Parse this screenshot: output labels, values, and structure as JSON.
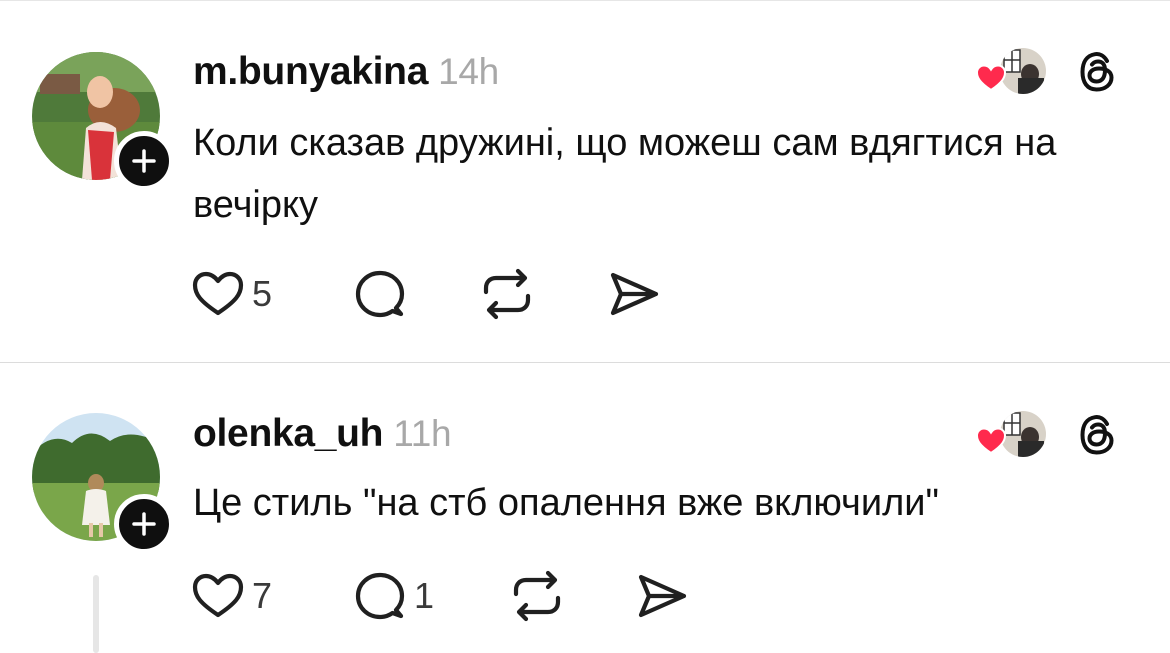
{
  "posts": [
    {
      "username": "m.bunyakina",
      "time": "14h",
      "text": "Коли сказав дружині, що можеш сам вдягтися на вечірку",
      "likes": "5",
      "replies": ""
    },
    {
      "username": "olenka_uh",
      "time": "11h",
      "text": "Це стиль \"на стб опалення вже включили\"",
      "likes": "7",
      "replies": "1"
    }
  ],
  "icons": {
    "follow": "plus-icon",
    "like": "heart-icon",
    "reply": "comment-icon",
    "repost": "repost-icon",
    "share": "send-icon",
    "app": "threads-logo-icon",
    "liked_badge": "red-heart-icon"
  },
  "colors": {
    "text": "#101010",
    "muted": "#a8a8a8",
    "heart": "#ff2a4d",
    "divider": "#dcdcdc"
  }
}
